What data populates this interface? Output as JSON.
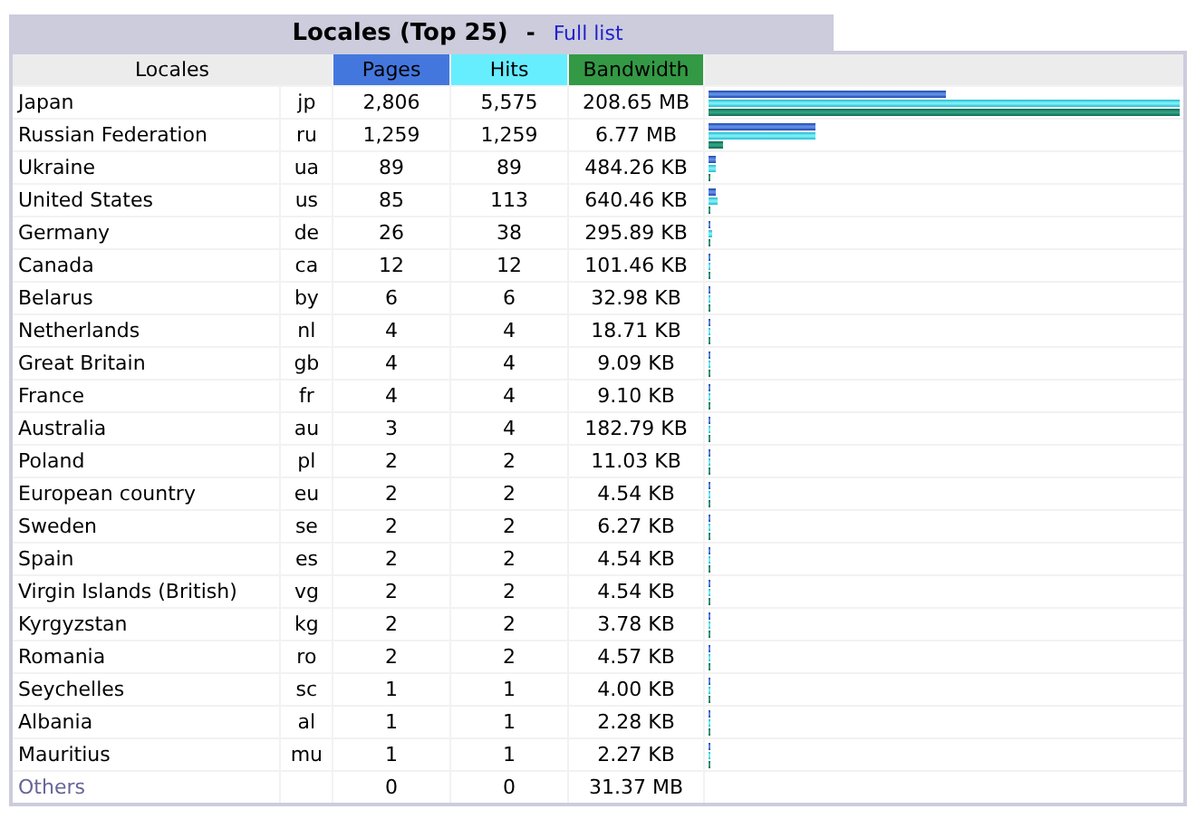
{
  "title": {
    "text": "Locales (Top 25)",
    "separator": "-",
    "link": "Full list"
  },
  "columns": [
    "Locales",
    "Pages",
    "Hits",
    "Bandwidth"
  ],
  "rows": [
    {
      "name": "Japan",
      "code": "jp",
      "pages": "2,806",
      "hits": "5,575",
      "bandwidth": "208.65 MB",
      "bars": [
        {
          "kind": "pages",
          "level": 0.503
        },
        {
          "kind": "hits",
          "level": 1
        },
        {
          "kind": "bandwidth",
          "level": 1
        }
      ]
    },
    {
      "name": "Russian Federation",
      "code": "ru",
      "pages": "1,259",
      "hits": "1,259",
      "bandwidth": "6.77 MB",
      "bars": [
        {
          "kind": "pages",
          "level": 0.226
        },
        {
          "kind": "hits",
          "level": 0.226
        },
        {
          "kind": "bandwidth",
          "level": 0.032
        }
      ]
    },
    {
      "name": "Ukraine",
      "code": "ua",
      "pages": "89",
      "hits": "89",
      "bandwidth": "484.26 KB",
      "bars": [
        {
          "kind": "pages",
          "level": 0.016
        },
        {
          "kind": "hits",
          "level": 0.016
        },
        {
          "kind": "bandwidth",
          "level": 0.002
        }
      ]
    },
    {
      "name": "United States",
      "code": "us",
      "pages": "85",
      "hits": "113",
      "bandwidth": "640.46 KB",
      "bars": [
        {
          "kind": "pages",
          "level": 0.015
        },
        {
          "kind": "hits",
          "level": 0.02
        },
        {
          "kind": "bandwidth",
          "level": 0.003
        }
      ]
    },
    {
      "name": "Germany",
      "code": "de",
      "pages": "26",
      "hits": "38",
      "bandwidth": "295.89 KB",
      "bars": [
        {
          "kind": "pages",
          "level": 0.005
        },
        {
          "kind": "hits",
          "level": 0.007
        },
        {
          "kind": "bandwidth",
          "level": 0.001
        }
      ]
    },
    {
      "name": "Canada",
      "code": "ca",
      "pages": "12",
      "hits": "12",
      "bandwidth": "101.46 KB",
      "bars": [
        {
          "kind": "pages",
          "level": 0.002
        },
        {
          "kind": "hits",
          "level": 0.002
        },
        {
          "kind": "bandwidth",
          "level": 0.001
        }
      ]
    },
    {
      "name": "Belarus",
      "code": "by",
      "pages": "6",
      "hits": "6",
      "bandwidth": "32.98 KB",
      "bars": [
        {
          "kind": "pages",
          "level": 0.001
        },
        {
          "kind": "hits",
          "level": 0.001
        },
        {
          "kind": "bandwidth",
          "level": 0.001
        }
      ]
    },
    {
      "name": "Netherlands",
      "code": "nl",
      "pages": "4",
      "hits": "4",
      "bandwidth": "18.71 KB",
      "bars": [
        {
          "kind": "pages",
          "level": 0.001
        },
        {
          "kind": "hits",
          "level": 0.001
        },
        {
          "kind": "bandwidth",
          "level": 0.001
        }
      ]
    },
    {
      "name": "Great Britain",
      "code": "gb",
      "pages": "4",
      "hits": "4",
      "bandwidth": "9.09 KB",
      "bars": [
        {
          "kind": "pages",
          "level": 0.001
        },
        {
          "kind": "hits",
          "level": 0.001
        },
        {
          "kind": "bandwidth",
          "level": 0.001
        }
      ]
    },
    {
      "name": "France",
      "code": "fr",
      "pages": "4",
      "hits": "4",
      "bandwidth": "9.10 KB",
      "bars": [
        {
          "kind": "pages",
          "level": 0.001
        },
        {
          "kind": "hits",
          "level": 0.001
        },
        {
          "kind": "bandwidth",
          "level": 0.001
        }
      ]
    },
    {
      "name": "Australia",
      "code": "au",
      "pages": "3",
      "hits": "4",
      "bandwidth": "182.79 KB",
      "bars": [
        {
          "kind": "pages",
          "level": 0.001
        },
        {
          "kind": "hits",
          "level": 0.001
        },
        {
          "kind": "bandwidth",
          "level": 0.001
        }
      ]
    },
    {
      "name": "Poland",
      "code": "pl",
      "pages": "2",
      "hits": "2",
      "bandwidth": "11.03 KB",
      "bars": [
        {
          "kind": "pages",
          "level": 0.001
        },
        {
          "kind": "hits",
          "level": 0.001
        },
        {
          "kind": "bandwidth",
          "level": 0.001
        }
      ]
    },
    {
      "name": "European country",
      "code": "eu",
      "pages": "2",
      "hits": "2",
      "bandwidth": "4.54 KB",
      "bars": [
        {
          "kind": "pages",
          "level": 0.001
        },
        {
          "kind": "hits",
          "level": 0.001
        },
        {
          "kind": "bandwidth",
          "level": 0.001
        }
      ]
    },
    {
      "name": "Sweden",
      "code": "se",
      "pages": "2",
      "hits": "2",
      "bandwidth": "6.27 KB",
      "bars": [
        {
          "kind": "pages",
          "level": 0.001
        },
        {
          "kind": "hits",
          "level": 0.001
        },
        {
          "kind": "bandwidth",
          "level": 0.001
        }
      ]
    },
    {
      "name": "Spain",
      "code": "es",
      "pages": "2",
      "hits": "2",
      "bandwidth": "4.54 KB",
      "bars": [
        {
          "kind": "pages",
          "level": 0.001
        },
        {
          "kind": "hits",
          "level": 0.001
        },
        {
          "kind": "bandwidth",
          "level": 0.001
        }
      ]
    },
    {
      "name": "Virgin Islands (British)",
      "code": "vg",
      "pages": "2",
      "hits": "2",
      "bandwidth": "4.54 KB",
      "bars": [
        {
          "kind": "pages",
          "level": 0.001
        },
        {
          "kind": "hits",
          "level": 0.001
        },
        {
          "kind": "bandwidth",
          "level": 0.001
        }
      ]
    },
    {
      "name": "Kyrgyzstan",
      "code": "kg",
      "pages": "2",
      "hits": "2",
      "bandwidth": "3.78 KB",
      "bars": [
        {
          "kind": "pages",
          "level": 0.001
        },
        {
          "kind": "hits",
          "level": 0.001
        },
        {
          "kind": "bandwidth",
          "level": 0.001
        }
      ]
    },
    {
      "name": "Romania",
      "code": "ro",
      "pages": "2",
      "hits": "2",
      "bandwidth": "4.57 KB",
      "bars": [
        {
          "kind": "pages",
          "level": 0.001
        },
        {
          "kind": "hits",
          "level": 0.001
        },
        {
          "kind": "bandwidth",
          "level": 0.001
        }
      ]
    },
    {
      "name": "Seychelles",
      "code": "sc",
      "pages": "1",
      "hits": "1",
      "bandwidth": "4.00 KB",
      "bars": [
        {
          "kind": "pages",
          "level": 0.001
        },
        {
          "kind": "hits",
          "level": 0.001
        },
        {
          "kind": "bandwidth",
          "level": 0.001
        }
      ]
    },
    {
      "name": "Albania",
      "code": "al",
      "pages": "1",
      "hits": "1",
      "bandwidth": "2.28 KB",
      "bars": [
        {
          "kind": "pages",
          "level": 0.001
        },
        {
          "kind": "hits",
          "level": 0.001
        },
        {
          "kind": "bandwidth",
          "level": 0.001
        }
      ]
    },
    {
      "name": "Mauritius",
      "code": "mu",
      "pages": "1",
      "hits": "1",
      "bandwidth": "2.27 KB",
      "bars": [
        {
          "kind": "pages",
          "level": 0.001
        },
        {
          "kind": "hits",
          "level": 0.001
        },
        {
          "kind": "bandwidth",
          "level": 0.001
        }
      ]
    }
  ],
  "others": {
    "name": "Others",
    "pages": "0",
    "hits": "0",
    "bandwidth": "31.37 MB"
  }
}
